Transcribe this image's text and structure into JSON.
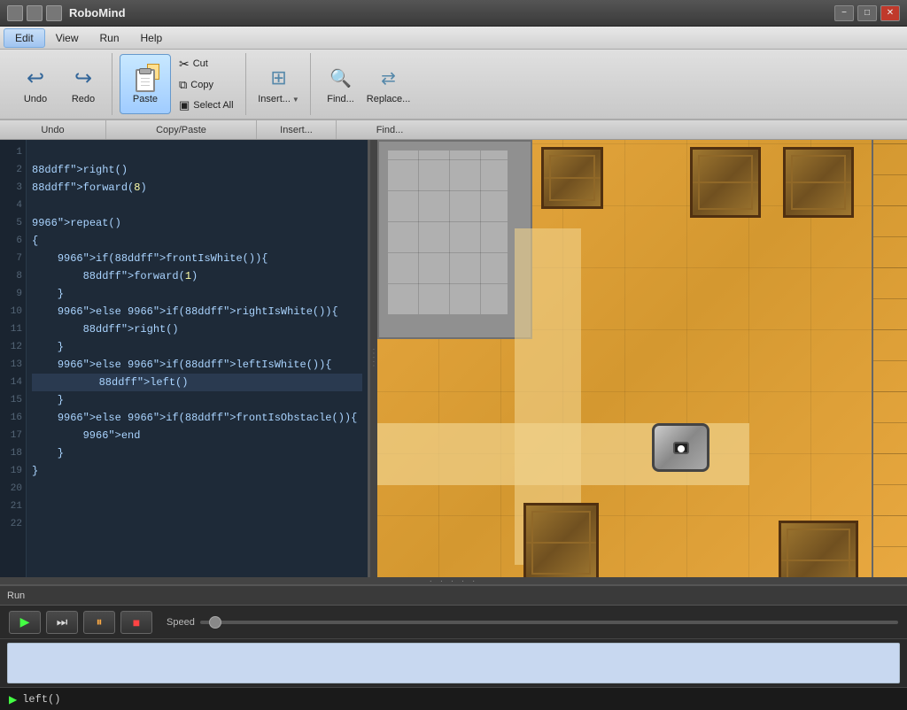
{
  "window": {
    "title": "RoboMind",
    "controls": {
      "minimize": "−",
      "maximize": "□",
      "close": "✕"
    }
  },
  "menu": {
    "items": [
      "Edit",
      "View",
      "Run",
      "Help"
    ],
    "active": "Edit"
  },
  "toolbar": {
    "undo_label": "Undo",
    "redo_label": "Redo",
    "paste_label": "Paste",
    "cut_label": "Cut",
    "copy_label": "Copy",
    "selectall_label": "Select All",
    "insert_label": "Insert...",
    "find_label": "Find...",
    "replace_label": "Replace...",
    "sections": {
      "undo": "Undo",
      "copypaste": "Copy/Paste",
      "insert": "Insert...",
      "find": "Find..."
    }
  },
  "code": {
    "lines": [
      {
        "num": 1,
        "text": "",
        "indent": 0,
        "current": false
      },
      {
        "num": 2,
        "text": "right()",
        "indent": 0,
        "current": false
      },
      {
        "num": 3,
        "text": "forward(8)",
        "indent": 0,
        "current": false
      },
      {
        "num": 4,
        "text": "",
        "indent": 0,
        "current": false
      },
      {
        "num": 5,
        "text": "repeat()",
        "indent": 0,
        "current": false
      },
      {
        "num": 6,
        "text": "{",
        "indent": 0,
        "current": false
      },
      {
        "num": 7,
        "text": "    if(frontIsWhite()){",
        "indent": 1,
        "current": false
      },
      {
        "num": 8,
        "text": "        forward(1)",
        "indent": 2,
        "current": false
      },
      {
        "num": 9,
        "text": "    }",
        "indent": 1,
        "current": false
      },
      {
        "num": 10,
        "text": "    else if(rightIsWhite()){",
        "indent": 1,
        "current": false
      },
      {
        "num": 11,
        "text": "        right()",
        "indent": 2,
        "current": false
      },
      {
        "num": 12,
        "text": "    }",
        "indent": 1,
        "current": false
      },
      {
        "num": 13,
        "text": "    else if(leftIsWhite()){",
        "indent": 1,
        "current": false
      },
      {
        "num": 14,
        "text": "        left()",
        "indent": 2,
        "current": true
      },
      {
        "num": 15,
        "text": "    }",
        "indent": 1,
        "current": false
      },
      {
        "num": 16,
        "text": "    else if(frontIsObstacle()){",
        "indent": 1,
        "current": false
      },
      {
        "num": 17,
        "text": "        end",
        "indent": 2,
        "current": false
      },
      {
        "num": 18,
        "text": "    }",
        "indent": 1,
        "current": false
      },
      {
        "num": 19,
        "text": "}",
        "indent": 0,
        "current": false
      },
      {
        "num": 20,
        "text": "",
        "indent": 0,
        "current": false
      },
      {
        "num": 21,
        "text": "",
        "indent": 0,
        "current": false
      },
      {
        "num": 22,
        "text": "",
        "indent": 0,
        "current": false
      }
    ]
  },
  "run": {
    "header": "Run",
    "play_label": "▶",
    "step_label": "⏭",
    "pause_label": "⏸",
    "stop_label": "■",
    "speed_label": "Speed"
  },
  "status": {
    "text": "left()"
  }
}
